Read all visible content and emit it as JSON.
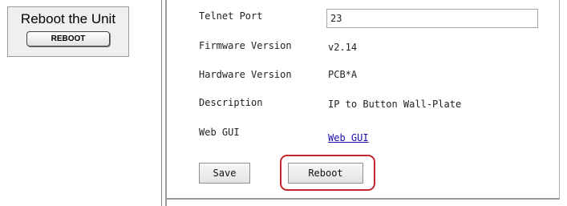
{
  "reboot_callout": {
    "title": "Reboot the Unit",
    "button_label": "REBOOT"
  },
  "settings": {
    "telnet_port": {
      "label": "Telnet Port",
      "value": "23"
    },
    "firmware": {
      "label": "Firmware Version",
      "value": "v2.14"
    },
    "hardware": {
      "label": "Hardware Version",
      "value": "PCB*A"
    },
    "description": {
      "label": "Description",
      "value": "IP to Button Wall-Plate"
    },
    "web_gui": {
      "label": "Web GUI",
      "link_text": "Web GUI"
    }
  },
  "actions": {
    "save_label": "Save",
    "reboot_label": "Reboot"
  },
  "colors": {
    "highlight": "#c4252c",
    "link": "#1a0dab"
  }
}
